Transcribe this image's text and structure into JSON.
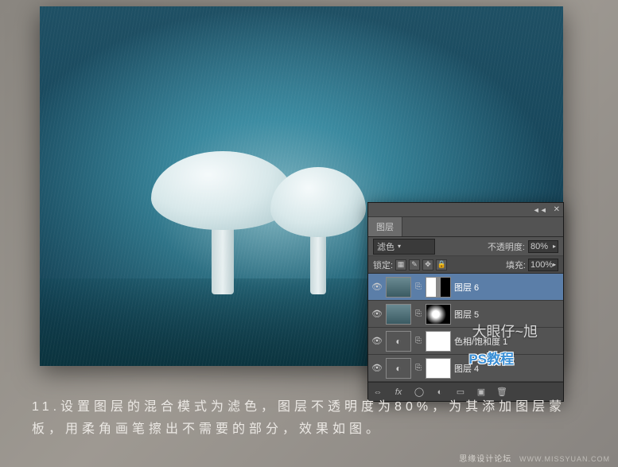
{
  "panel": {
    "tab": "图层",
    "blend_label": "",
    "blend_mode": "滤色",
    "opacity_label": "不透明度:",
    "opacity_value": "80%",
    "lock_label": "锁定:",
    "fill_label": "填充:",
    "fill_value": "100%"
  },
  "layers": [
    {
      "name": "图层 6",
      "selected": true
    },
    {
      "name": "图层 5",
      "selected": false
    },
    {
      "name": "色相/饱和度 1",
      "selected": false
    },
    {
      "name": "图层 4",
      "selected": false
    }
  ],
  "watermark": {
    "line1": "大眼仔~旭",
    "line2": "PS教程"
  },
  "caption": "11.设置图层的混合模式为滤色，图层不透明度为80%，为其添加图层蒙板，用柔角画笔擦出不需要的部分，效果如图。",
  "footer": {
    "brand": "思缘设计论坛",
    "url": "WWW.MISSYUAN.COM"
  }
}
